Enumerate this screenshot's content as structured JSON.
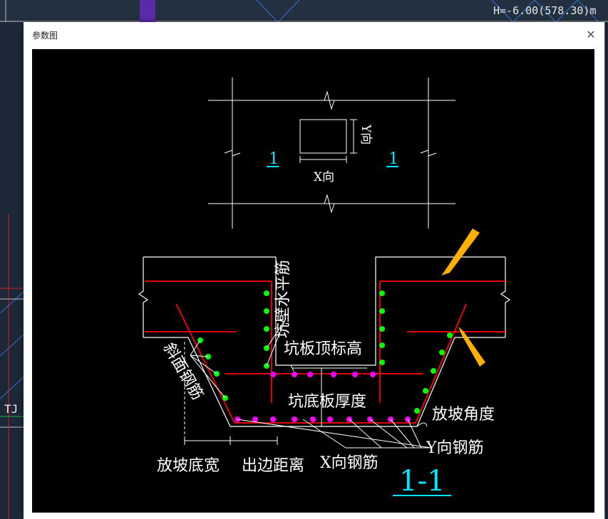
{
  "background": {
    "status_text": "H=-6.00(578.30)m",
    "side_label": "TJ"
  },
  "dialog": {
    "title": "参数图",
    "close_icon": "close-icon"
  },
  "figure": {
    "plan_labels": {
      "section_left": "1",
      "section_right": "1",
      "x_dir": "X向",
      "y_dir": "Y向"
    },
    "section_labels": {
      "wall_horizontal_rebar": "坑壁水平筋",
      "slab_top_elevation": "坑板顶标高",
      "bottom_slab_thickness": "坑底板厚度",
      "slope_angle": "放坡角度",
      "slope_rebar": "斜面钢筋",
      "slope_bottom_width": "放坡底宽",
      "edge_distance": "出边距离",
      "x_rebar": "X向钢筋",
      "y_rebar": "Y向钢筋",
      "section_title": "1-1"
    },
    "colors": {
      "rebar_line": "#ff0000",
      "wall_bar_dot": "#00ff00",
      "bottom_bar_dot": "#ff00ff",
      "section_mark": "#00e5ff",
      "arrow": "#ffb000"
    }
  }
}
